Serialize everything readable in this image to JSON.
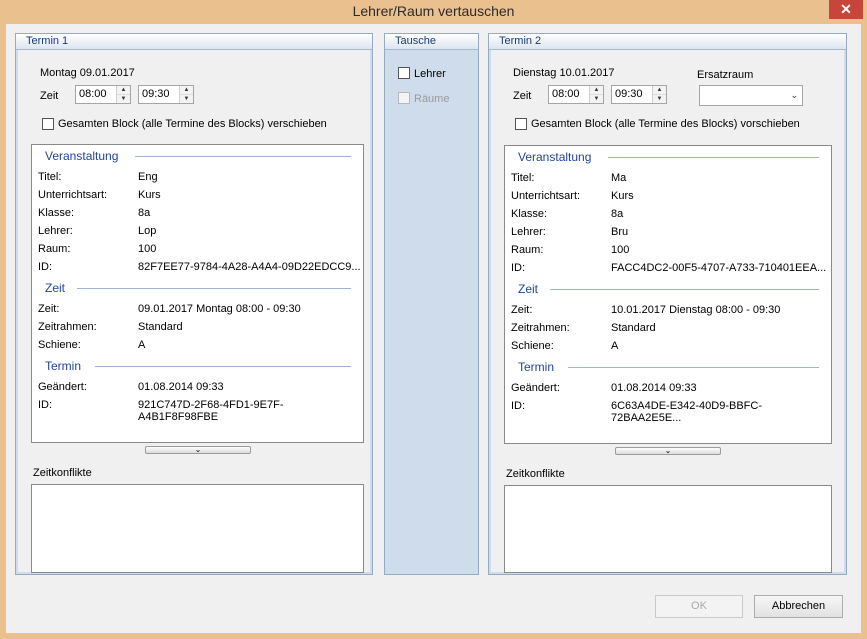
{
  "window": {
    "title": "Lehrer/Raum vertauschen",
    "close_glyph": "✕"
  },
  "termin1": {
    "header": "Termin 1",
    "date": "Montag 09.01.2017",
    "zeit_label": "Zeit",
    "start": "08:00",
    "end": "09:30",
    "block_label": "Gesamten Block (alle Termine des Blocks) verschieben",
    "sections": {
      "veranstaltung": "Veranstaltung",
      "zeit": "Zeit",
      "termin": "Termin"
    },
    "rows": {
      "titel": [
        "Titel:",
        "Eng"
      ],
      "art": [
        "Unterrichtsart:",
        "Kurs"
      ],
      "klasse": [
        "Klasse:",
        "8a"
      ],
      "lehrer": [
        "Lehrer:",
        "Lop"
      ],
      "raum": [
        "Raum:",
        "100"
      ],
      "id1": [
        "ID:",
        "82F7EE77-9784-4A28-A4A4-09D22EDCC9..."
      ],
      "zeit": [
        "Zeit:",
        "09.01.2017 Montag 08:00 - 09:30"
      ],
      "rahmen": [
        "Zeitrahmen:",
        "Standard"
      ],
      "schiene": [
        "Schiene:",
        "A"
      ],
      "geaendert": [
        "Geändert:",
        "01.08.2014 09:33"
      ],
      "id2": [
        "ID:",
        "921C747D-2F68-4FD1-9E7F-A4B1F8F98FBE"
      ]
    },
    "conflicts_label": "Zeitkonflikte"
  },
  "tausche": {
    "header": "Tausche",
    "lehrer": "Lehrer",
    "raeume": "Räume"
  },
  "termin2": {
    "header": "Termin 2",
    "date": "Dienstag 10.01.2017",
    "zeit_label": "Zeit",
    "start": "08:00",
    "end": "09:30",
    "ersatzraum_label": "Ersatzraum",
    "ersatzraum_value": "",
    "block_label": "Gesamten Block (alle Termine des Blocks) vorschieben",
    "sections": {
      "veranstaltung": "Veranstaltung",
      "zeit": "Zeit",
      "termin": "Termin"
    },
    "rows": {
      "titel": [
        "Titel:",
        "Ma"
      ],
      "art": [
        "Unterrichtsart:",
        "Kurs"
      ],
      "klasse": [
        "Klasse:",
        "8a"
      ],
      "lehrer": [
        "Lehrer:",
        "Bru"
      ],
      "raum": [
        "Raum:",
        "100"
      ],
      "id1": [
        "ID:",
        "FACC4DC2-00F5-4707-A733-710401EEA..."
      ],
      "zeit": [
        "Zeit:",
        "10.01.2017 Dienstag 08:00 - 09:30"
      ],
      "rahmen": [
        "Zeitrahmen:",
        "Standard"
      ],
      "schiene": [
        "Schiene:",
        "A"
      ],
      "geaendert": [
        "Geändert:",
        "01.08.2014 09:33"
      ],
      "id2": [
        "ID:",
        "6C63A4DE-E342-40D9-BBFC-72BAA2E5E..."
      ]
    },
    "conflicts_label": "Zeitkonflikte"
  },
  "buttons": {
    "ok": "OK",
    "cancel": "Abbrechen"
  },
  "icons": {
    "spin_up": "▲",
    "spin_down": "▼",
    "combo_arrow": "chevron-down-icon",
    "expander": "chevron-down-icon"
  }
}
